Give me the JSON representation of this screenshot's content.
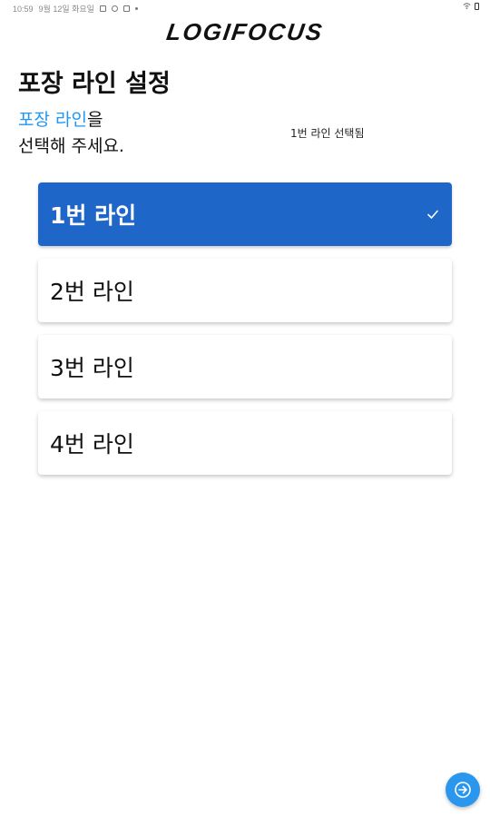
{
  "status_bar": {
    "time": "10:59",
    "date": "9월 12일 화요일"
  },
  "brand": {
    "logo_text": "LOGIFOCUS"
  },
  "page": {
    "title": "포장 라인 설정"
  },
  "instruction": {
    "highlight": "포장 라인",
    "suffix": "을",
    "line2": "선택해 주세요."
  },
  "selection_status": "1번 라인 선택됨",
  "line_options": [
    {
      "label": "1번 라인",
      "selected": true
    },
    {
      "label": "2번 라인",
      "selected": false
    },
    {
      "label": "3번 라인",
      "selected": false
    },
    {
      "label": "4번 라인",
      "selected": false
    }
  ],
  "colors": {
    "selected_bg": "#1e66c8",
    "accent": "#2196f3",
    "fab": "#2a96ee"
  },
  "icons": {
    "check": "check-icon",
    "next": "arrow-right-icon"
  }
}
